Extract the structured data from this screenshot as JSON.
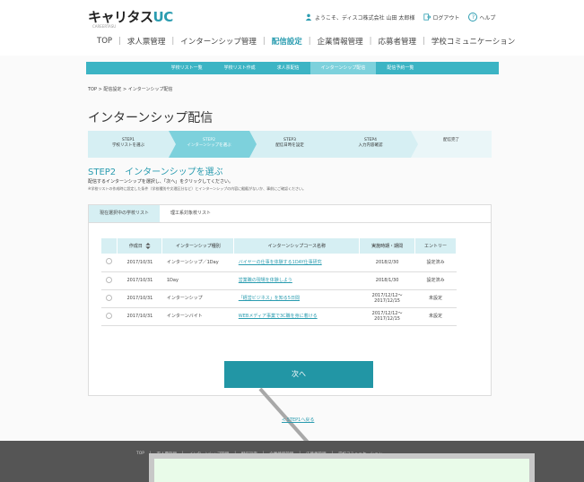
{
  "header": {
    "logo_main": "キャリタス",
    "logo_uc": "UC",
    "logo_sub": "CAREERTASU",
    "welcome": "ようこそ、ディスコ株式会社 山田 太郎様",
    "logout": "ログアウト",
    "help": "ヘルプ"
  },
  "main_nav": [
    "TOP",
    "求人票管理",
    "インターンシップ管理",
    "配信設定",
    "企業情報管理",
    "応募者管理",
    "学校コミュニケーション"
  ],
  "main_nav_active": 3,
  "sub_nav": [
    "学校リスト一覧",
    "学校リスト作成",
    "求人票配信",
    "インターンシップ配信",
    "配信予約一覧"
  ],
  "sub_nav_active": 3,
  "breadcrumb": "TOP > 配信設定 > インターンシップ配信",
  "page_title": "インターンシップ配信",
  "steps": [
    {
      "num": "STEP1",
      "label": "学校リストを選ぶ"
    },
    {
      "num": "STEP2",
      "label": "インターンシップを選ぶ"
    },
    {
      "num": "STEP3",
      "label": "配信日時を設定"
    },
    {
      "num": "STEP4",
      "label": "入力内容確認"
    },
    {
      "num": "",
      "label": "配信完了"
    }
  ],
  "step_active": 1,
  "step_heading": "STEP2　インターンシップを選ぶ",
  "instruction": "配信するインターンシップを選択し、「次へ」をクリックしてください。",
  "note": "※学校リストの作成時に設定した条件（学校種別や文理区分など）とインターンシップの内容に齟齬がないか、事前にご確認ください。",
  "tabs": [
    "現在選択中の学校リスト",
    "理工系対象校リスト"
  ],
  "tab_active": 0,
  "table": {
    "headers": [
      "",
      "作成日",
      "インターンシップ種別",
      "インターンシップコース名称",
      "実施時期・期間",
      "エントリー"
    ],
    "rows": [
      {
        "date": "2017/10/31",
        "type": "インターンシップ／1Day",
        "course": "バイヤーの仕事を体験する1DAY仕事研究",
        "period": "2018/2/30",
        "entry": "設定済み"
      },
      {
        "date": "2017/10/31",
        "type": "1Day",
        "course": "営業職の現場を体験しよう",
        "period": "2018/1/30",
        "entry": "設定済み"
      },
      {
        "date": "2017/10/31",
        "type": "インターンシップ",
        "course": "「経営ビジネス」を知る5日間",
        "period": "2017/12/12～ 2017/12/15",
        "entry": "未設定"
      },
      {
        "date": "2017/10/31",
        "type": "インターンバイト",
        "course": "WEBメディア事業で3C職を身に着ける",
        "period": "2017/12/12～ 2017/12/15",
        "entry": "未設定"
      }
    ]
  },
  "next_button": "次へ",
  "back_link": "< STEP1へ戻る",
  "footer_nav": [
    "TOP",
    "求人票管理",
    "インターンシップ管理",
    "配信設定",
    "企業情報管理",
    "応募者管理",
    "学校コミュニケーション"
  ],
  "colors": {
    "accent": "#2a9cb0",
    "subnav": "#3cb4c4",
    "button": "#2296a5",
    "footer": "#555555"
  }
}
